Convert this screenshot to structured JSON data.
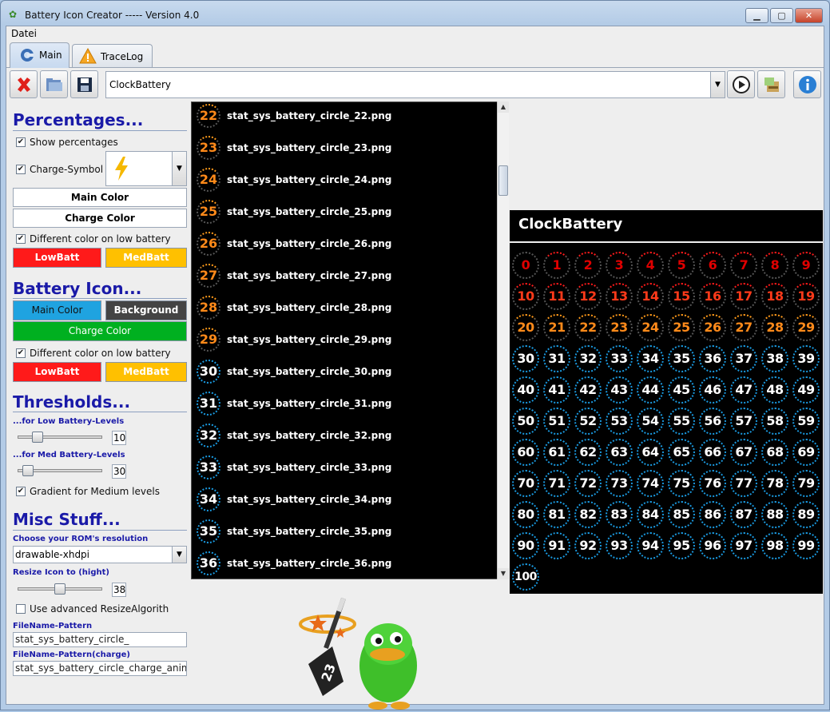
{
  "window": {
    "title": "Battery Icon Creator ----- Version 4.0",
    "minimize": "▁",
    "maximize": "▢",
    "close": "✕"
  },
  "menu": {
    "file": "Datei"
  },
  "tabs": [
    {
      "label": "Main",
      "icon": "main-app-icon"
    },
    {
      "label": "TraceLog",
      "icon": "warning-icon"
    }
  ],
  "toolbar": {
    "theme_value": "ClockBattery",
    "delete_icon": "delete-icon",
    "open_icon": "open-folder-icon",
    "save_icon": "save-icon",
    "play_icon": "play-icon",
    "export_icon": "export-icon",
    "info_icon": "info-icon"
  },
  "percentages": {
    "heading": "Percentages...",
    "show_percentages": "Show percentages",
    "charge_symbol": "Charge-Symbol",
    "charge_symbol_icon": "lightning-bolt-icon",
    "main_color": "Main Color",
    "charge_color": "Charge Color",
    "different_color": "Different color on low battery",
    "low_batt": "LowBatt",
    "med_batt": "MedBatt"
  },
  "battery_icon": {
    "heading": "Battery Icon...",
    "main_color": "Main Color",
    "background": "Background",
    "charge_color": "Charge Color",
    "different_color": "Different color on low battery",
    "low_batt": "LowBatt",
    "med_batt": "MedBatt"
  },
  "thresholds": {
    "heading": "Thresholds...",
    "low_label": "...for Low Battery-Levels",
    "low_value": "10",
    "low_fraction": 0.2,
    "med_label": "...for Med Battery-Levels",
    "med_value": "30",
    "med_fraction": 0.07,
    "gradient": "Gradient for Medium levels"
  },
  "misc": {
    "heading": "Misc Stuff...",
    "resolution_label": "Choose your ROM's resolution",
    "resolution_value": "drawable-xhdpi",
    "resize_label": "Resize Icon to (hight)",
    "resize_value": "38",
    "resize_fraction": 0.5,
    "advanced_resize": "Use advanced ResizeAlgorith",
    "pattern_label": "FileName-Pattern",
    "pattern_value": "stat_sys_battery_circle_",
    "pattern_charge_label": "FileName-Pattern(charge)",
    "pattern_charge_value": "stat_sys_battery_circle_charge_anim"
  },
  "file_list": [
    {
      "num": "22",
      "name": "stat_sys_battery_circle_22.png"
    },
    {
      "num": "23",
      "name": "stat_sys_battery_circle_23.png"
    },
    {
      "num": "24",
      "name": "stat_sys_battery_circle_24.png"
    },
    {
      "num": "25",
      "name": "stat_sys_battery_circle_25.png"
    },
    {
      "num": "26",
      "name": "stat_sys_battery_circle_26.png"
    },
    {
      "num": "27",
      "name": "stat_sys_battery_circle_27.png"
    },
    {
      "num": "28",
      "name": "stat_sys_battery_circle_28.png"
    },
    {
      "num": "29",
      "name": "stat_sys_battery_circle_29.png"
    },
    {
      "num": "30",
      "name": "stat_sys_battery_circle_30.png"
    },
    {
      "num": "31",
      "name": "stat_sys_battery_circle_31.png"
    },
    {
      "num": "32",
      "name": "stat_sys_battery_circle_32.png"
    },
    {
      "num": "33",
      "name": "stat_sys_battery_circle_33.png"
    },
    {
      "num": "34",
      "name": "stat_sys_battery_circle_34.png"
    },
    {
      "num": "35",
      "name": "stat_sys_battery_circle_35.png"
    },
    {
      "num": "36",
      "name": "stat_sys_battery_circle_36.png"
    }
  ],
  "preview": {
    "title": "ClockBattery",
    "levels": [
      "0",
      "1",
      "2",
      "3",
      "4",
      "5",
      "6",
      "7",
      "8",
      "9",
      "10",
      "11",
      "12",
      "13",
      "14",
      "15",
      "16",
      "17",
      "18",
      "19",
      "20",
      "21",
      "22",
      "23",
      "24",
      "25",
      "26",
      "27",
      "28",
      "29",
      "30",
      "31",
      "32",
      "33",
      "34",
      "35",
      "36",
      "37",
      "38",
      "39",
      "40",
      "41",
      "42",
      "43",
      "44",
      "45",
      "46",
      "47",
      "48",
      "49",
      "50",
      "51",
      "52",
      "53",
      "54",
      "55",
      "56",
      "57",
      "58",
      "59",
      "60",
      "61",
      "62",
      "63",
      "64",
      "65",
      "66",
      "67",
      "68",
      "69",
      "70",
      "71",
      "72",
      "73",
      "74",
      "75",
      "76",
      "77",
      "78",
      "79",
      "80",
      "81",
      "82",
      "83",
      "84",
      "85",
      "86",
      "87",
      "88",
      "89",
      "90",
      "91",
      "92",
      "93",
      "94",
      "95",
      "96",
      "97",
      "98",
      "99",
      "100"
    ]
  },
  "colors": {
    "low": "#ff1a1a",
    "low_text": "#e00000",
    "med": "#ff9a1a",
    "med_button": "#ffc000",
    "main": "#1a9ae0",
    "main_button": "#1fa3e0",
    "background_button": "#444444",
    "charge_button": "#00b020",
    "heading": "#1a1aa8"
  },
  "mascot_icon": "mascot-duck-icon"
}
